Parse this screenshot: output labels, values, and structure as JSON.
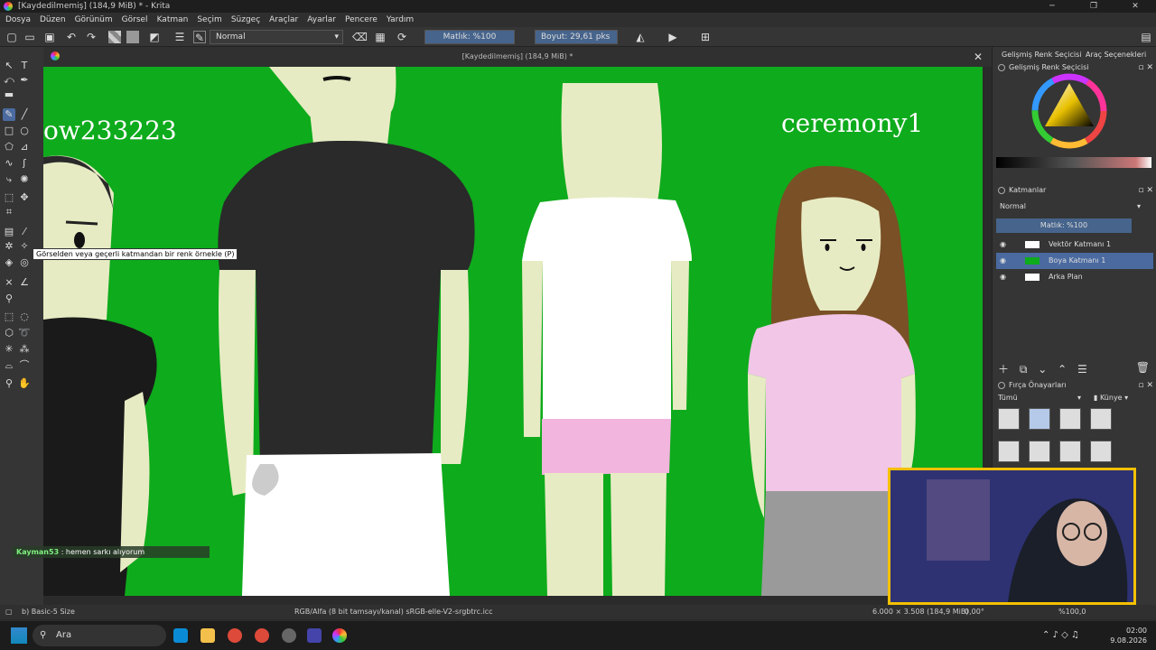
{
  "window": {
    "title": "[Kaydedilmemiş]  (184,9 MiB) * - Krita",
    "controls": [
      "─",
      "❐",
      "✕"
    ]
  },
  "menu": [
    "Dosya",
    "Düzen",
    "Görünüm",
    "Görsel",
    "Katman",
    "Seçim",
    "Süzgeç",
    "Araçlar",
    "Ayarlar",
    "Pencere",
    "Yardım"
  ],
  "toolbar": {
    "blend_mode": "Normal",
    "opacity": "Matlık: %100",
    "size": "Boyut: 29,61 pks"
  },
  "document": {
    "tab_title": "[Kaydedilmemiş]  (184,9 MiB) *"
  },
  "canvas": {
    "background": "#0eab1c",
    "left_text": "ow233223",
    "right_text": "ceremony1"
  },
  "tooltip": "Görselden veya geçerli katmandan bir renk örnekle (P)",
  "chat": {
    "user": "Kayman53",
    "message": ": hemen sarkı alıyorum"
  },
  "dock": {
    "tabs": [
      "Gelişmiş Renk Seçicisi",
      "Araç Seçenekleri"
    ],
    "color_panel_title": "Gelişmiş Renk Seçicisi",
    "layers_title": "Katmanlar",
    "layers_blend": "Normal",
    "layers_opacity": "Matlık: %100",
    "layers": [
      {
        "name": "Vektör Katmanı 1",
        "active": false
      },
      {
        "name": "Boya Katmanı 1",
        "active": true
      },
      {
        "name": "Arka Plan",
        "active": false
      }
    ],
    "brushes_title": "Fırça Önayarları",
    "brushes_filter": "Tümü",
    "brushes_tag": "Künye"
  },
  "status": {
    "brush": "b) Basic-5 Size",
    "color_space": "RGB/Alfa (8 bit tamsayı/kanal)  sRGB-elle-V2-srgbtrc.icc",
    "dimensions": "6.000 × 3.508 (184,9 MiB)",
    "rotation": "0,00°",
    "zoom": "%100,0"
  },
  "taskbar": {
    "search_placeholder": "Ara",
    "time": "02:00",
    "date": "9.08.2026"
  }
}
